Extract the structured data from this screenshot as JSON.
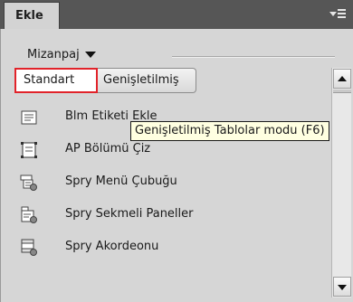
{
  "panel": {
    "title": "Ekle",
    "menu_icon": "panel-options-icon"
  },
  "category": {
    "label": "Mizanpaj",
    "dropdown_icon": "caret-down-icon"
  },
  "modes": {
    "standard": "Standart",
    "extended": "Genişletilmiş"
  },
  "tooltip": "Genişletilmiş Tablolar modu (F6)",
  "items": [
    {
      "label": "Blm Etiketi Ekle",
      "icon": "div-tag-icon"
    },
    {
      "label": "AP Bölümü Çiz",
      "icon": "ap-div-icon"
    },
    {
      "label": "Spry Menü Çubuğu",
      "icon": "spry-menu-bar-icon"
    },
    {
      "label": "Spry Sekmeli Paneller",
      "icon": "spry-tabbed-panels-icon"
    },
    {
      "label": "Spry Akordeonu",
      "icon": "spry-accordion-icon"
    }
  ],
  "colors": {
    "header_bg": "#565656",
    "panel_bg": "#d6d6d6",
    "highlight_border": "#e1232a",
    "tooltip_bg": "#ffffe1"
  }
}
